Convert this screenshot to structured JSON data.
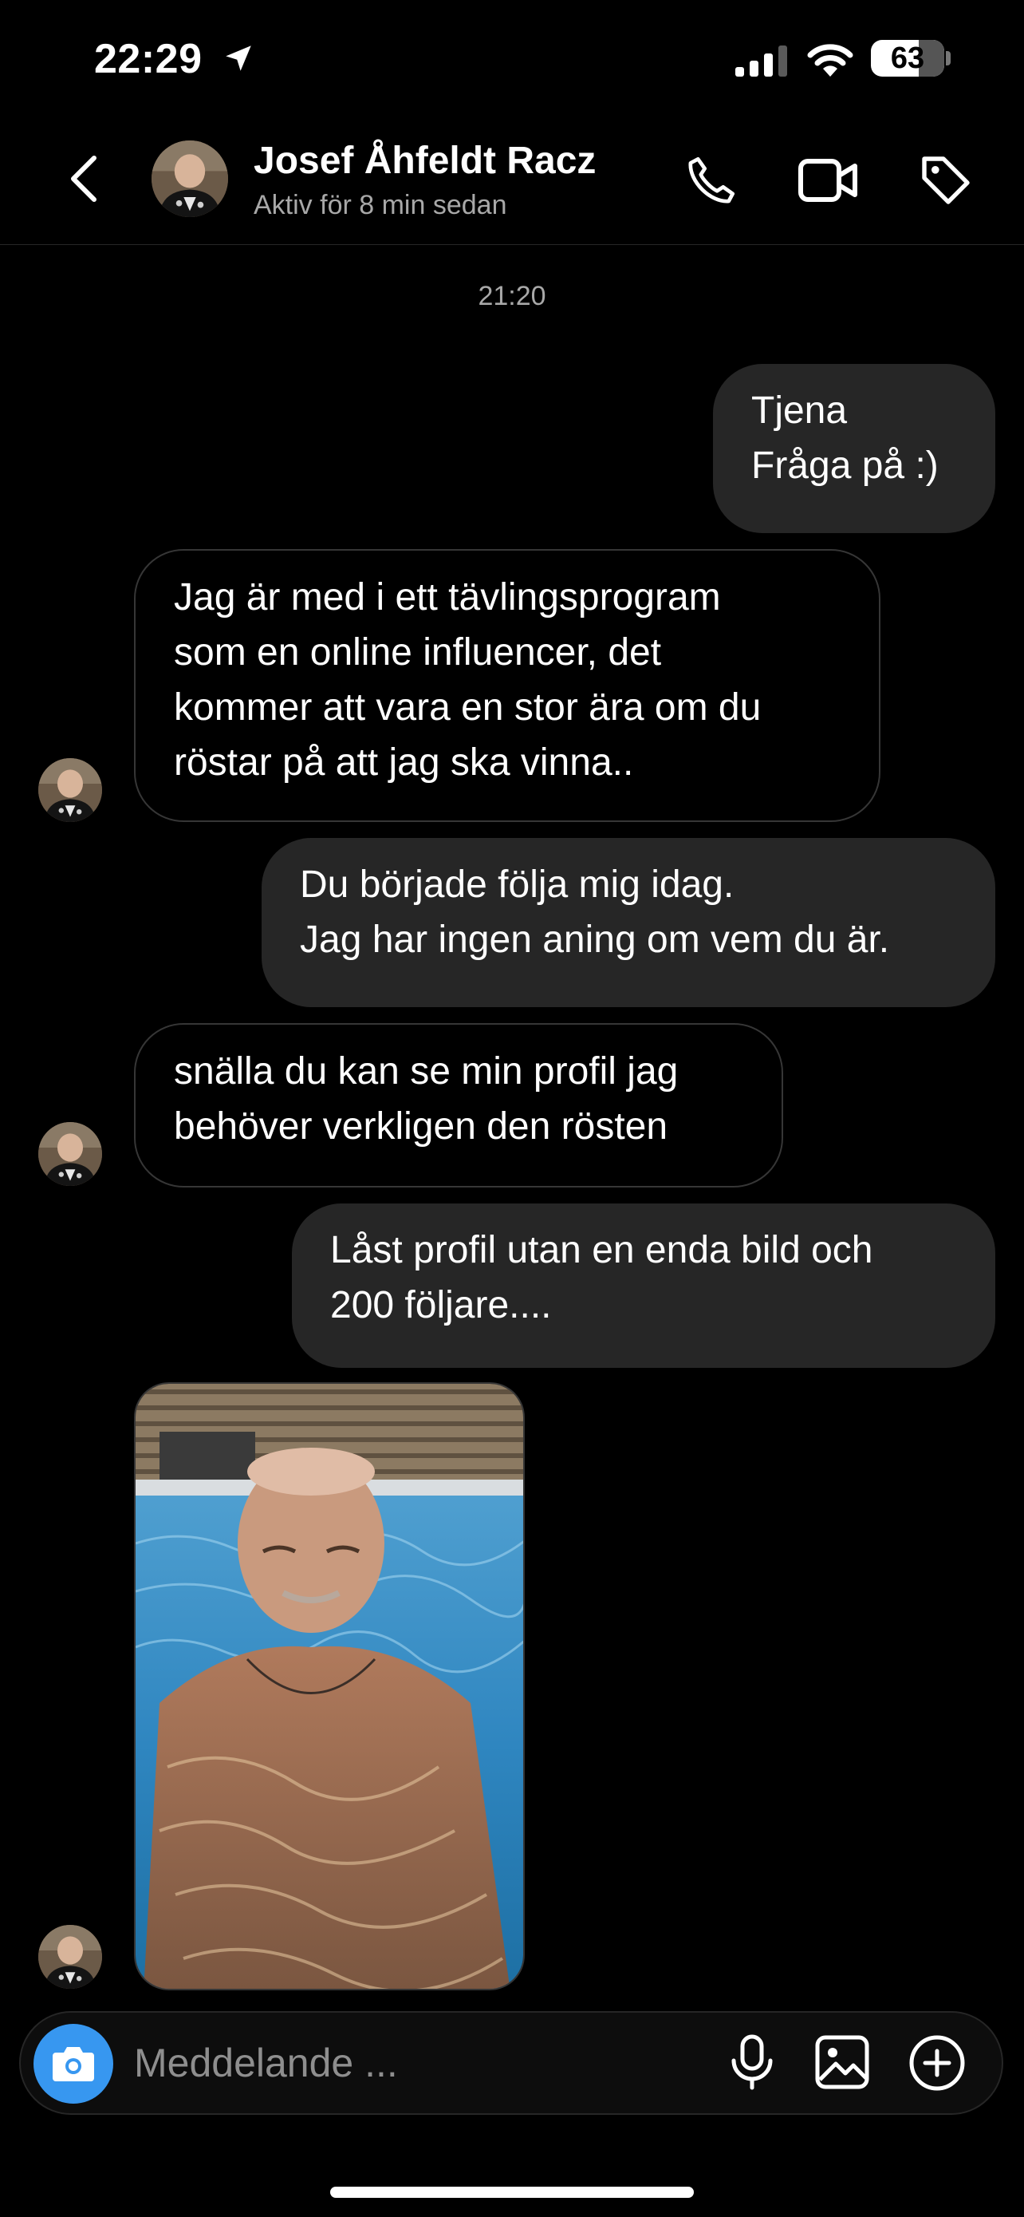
{
  "status_bar": {
    "time": "22:29",
    "battery": "63",
    "icons": [
      "location-arrow-icon",
      "signal-icon",
      "wifi-icon",
      "battery-icon"
    ]
  },
  "header": {
    "contact_name": "Josef Åhfeldt Racz",
    "contact_status": "Aktiv för 8 min sedan",
    "icons": [
      "back-icon",
      "avatar",
      "phone-icon",
      "video-icon",
      "tag-icon"
    ]
  },
  "conversation": {
    "timestamp": "21:20",
    "messages": [
      {
        "sender": "me",
        "lines": [
          "Tjena",
          "Fråga på :)"
        ]
      },
      {
        "sender": "them",
        "lines": [
          "Jag är med i ett tävlingsprogram",
          "som en online influencer, det",
          "kommer att vara en stor ära om du",
          "röstar på att jag ska vinna.."
        ]
      },
      {
        "sender": "me",
        "lines": [
          "Du började följa mig idag.",
          "Jag har ingen aning om vem du är."
        ]
      },
      {
        "sender": "them",
        "lines": [
          "snälla du kan se min profil jag",
          "behöver verkligen den rösten"
        ]
      },
      {
        "sender": "me",
        "lines": [
          "Låst profil utan en enda bild och",
          "200 följare...."
        ]
      },
      {
        "sender": "them",
        "type": "photo"
      }
    ]
  },
  "composer": {
    "placeholder": "Meddelande ...",
    "icons": [
      "camera-icon",
      "microphone-icon",
      "gallery-icon",
      "plus-circle-icon"
    ]
  },
  "colors": {
    "background": "#000000",
    "outgoing_bubble": "#262626",
    "incoming_border": "#363636",
    "camera_button": "#3797f0",
    "secondary_text": "#a8a8a8"
  }
}
